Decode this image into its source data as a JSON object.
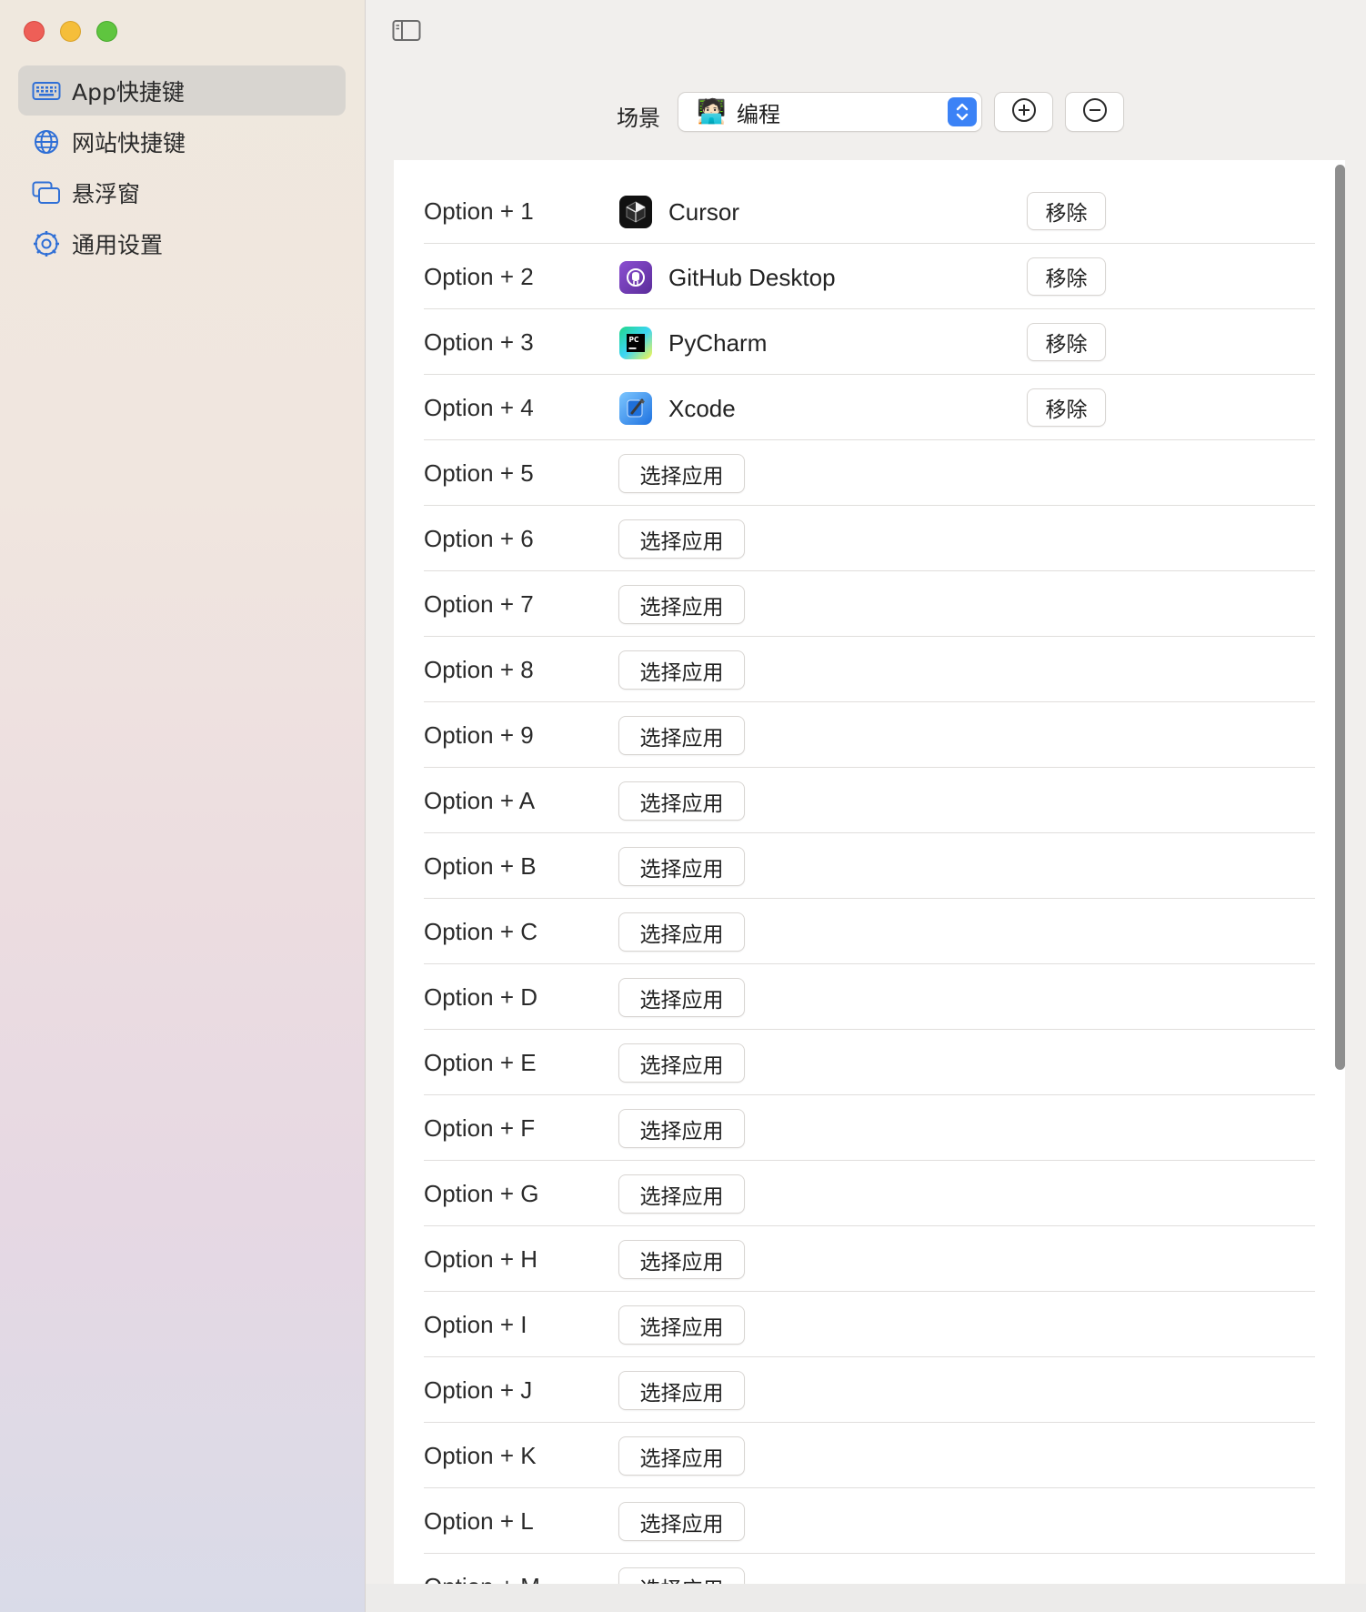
{
  "sidebar": {
    "items": [
      {
        "label": "App快捷键",
        "icon": "keyboard-icon",
        "active": true
      },
      {
        "label": "网站快捷键",
        "icon": "globe-icon",
        "active": false
      },
      {
        "label": "悬浮窗",
        "icon": "floating-windows-icon",
        "active": false
      },
      {
        "label": "通用设置",
        "icon": "gear-icon",
        "active": false
      }
    ]
  },
  "scene": {
    "label": "场景",
    "emoji": "🧑🏻‍💻",
    "value": "编程"
  },
  "shortcuts": {
    "assigned": [
      {
        "key": "Option + 1",
        "app": "Cursor",
        "icon": "cursor-app-icon",
        "remove_label": "移除"
      },
      {
        "key": "Option + 2",
        "app": "GitHub Desktop",
        "icon": "github-desktop-icon",
        "remove_label": "移除"
      },
      {
        "key": "Option + 3",
        "app": "PyCharm",
        "icon": "pycharm-icon",
        "remove_label": "移除"
      },
      {
        "key": "Option + 4",
        "app": "Xcode",
        "icon": "xcode-icon",
        "remove_label": "移除"
      }
    ],
    "choose_label": "选择应用",
    "unassigned": [
      "Option + 5",
      "Option + 6",
      "Option + 7",
      "Option + 8",
      "Option + 9",
      "Option + A",
      "Option + B",
      "Option + C",
      "Option + D",
      "Option + E",
      "Option + F",
      "Option + G",
      "Option + H",
      "Option + I",
      "Option + J",
      "Option + K",
      "Option + L",
      "Option + M"
    ]
  },
  "colors": {
    "accent": "#3b82f6",
    "sidebar_icon": "#2f6fd6"
  }
}
